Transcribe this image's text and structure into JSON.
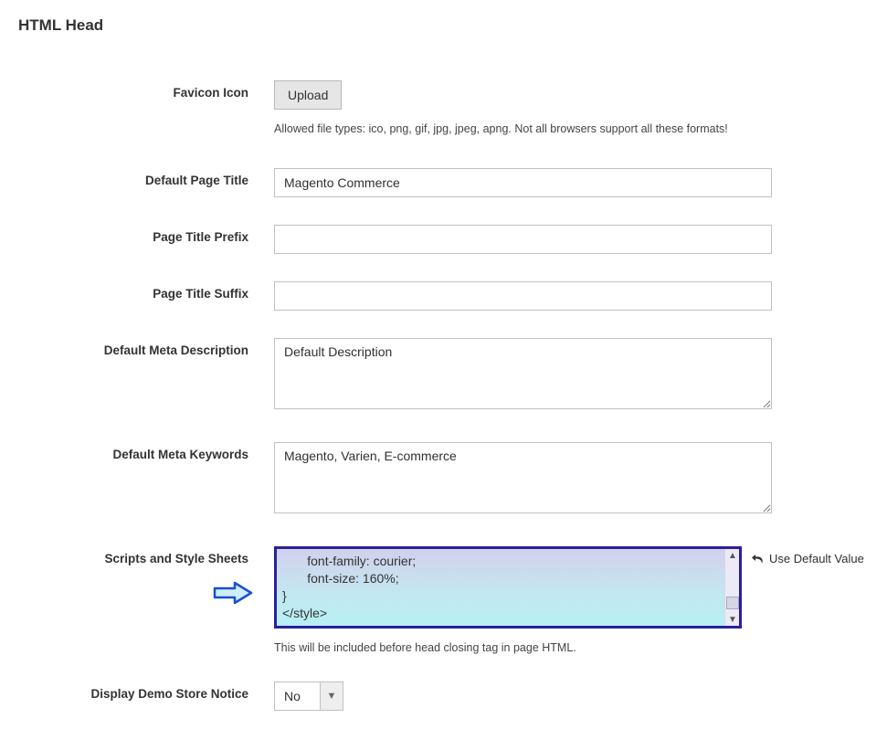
{
  "section": {
    "title": "HTML Head"
  },
  "favicon": {
    "label": "Favicon Icon",
    "button": "Upload",
    "hint": "Allowed file types: ico, png, gif, jpg, jpeg, apng. Not all browsers support all these formats!"
  },
  "pageTitle": {
    "label": "Default Page Title",
    "value": "Magento Commerce"
  },
  "prefix": {
    "label": "Page Title Prefix",
    "value": ""
  },
  "suffix": {
    "label": "Page Title Suffix",
    "value": ""
  },
  "metaDesc": {
    "label": "Default Meta Description",
    "value": "Default Description"
  },
  "metaKeys": {
    "label": "Default Meta Keywords",
    "value": "Magento, Varien, E-commerce"
  },
  "scripts": {
    "label": "Scripts and Style Sheets",
    "content": "       font-family: courier;\n       font-size: 160%;\n}\n</style>",
    "hint": "This will be included before head closing tag in page HTML.",
    "useDefault": "Use Default Value"
  },
  "demo": {
    "label": "Display Demo Store Notice",
    "value": "No"
  }
}
